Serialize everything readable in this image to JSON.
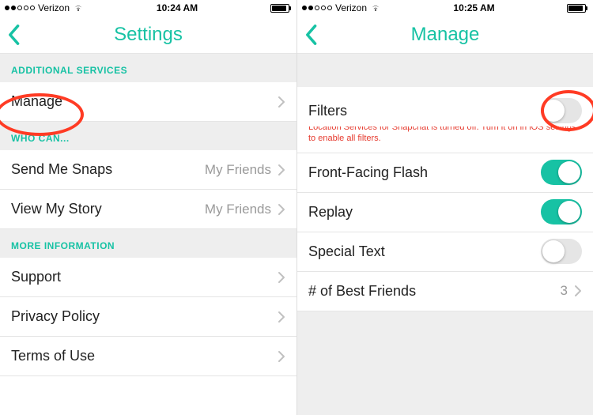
{
  "left": {
    "status": {
      "carrier": "Verizon",
      "time": "10:24 AM"
    },
    "nav": {
      "title": "Settings"
    },
    "sections": {
      "additional_services": {
        "header": "ADDITIONAL SERVICES",
        "manage": {
          "label": "Manage"
        }
      },
      "who_can": {
        "header": "WHO CAN...",
        "send_me_snaps": {
          "label": "Send Me Snaps",
          "value": "My Friends"
        },
        "view_my_story": {
          "label": "View My Story",
          "value": "My Friends"
        }
      },
      "more_info": {
        "header": "MORE INFORMATION",
        "support": {
          "label": "Support"
        },
        "privacy": {
          "label": "Privacy Policy"
        },
        "terms": {
          "label": "Terms of Use"
        }
      }
    }
  },
  "right": {
    "status": {
      "carrier": "Verizon",
      "time": "10:25 AM"
    },
    "nav": {
      "title": "Manage"
    },
    "rows": {
      "filters": {
        "label": "Filters",
        "sub": "Location Services for Snapchat is turned off. Turn it on in iOS settings to enable all filters.",
        "on": false
      },
      "front_flash": {
        "label": "Front-Facing Flash",
        "on": true
      },
      "replay": {
        "label": "Replay",
        "on": true
      },
      "special_text": {
        "label": "Special Text",
        "on": false
      },
      "best_friends": {
        "label": "# of Best Friends",
        "value": "3"
      }
    }
  },
  "colors": {
    "accent": "#17c2a4",
    "error": "#e63a2e",
    "annotation": "#ff3b24"
  }
}
